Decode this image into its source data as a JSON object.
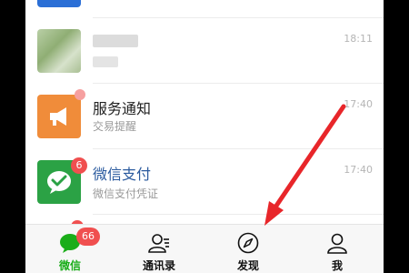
{
  "chats": [
    {
      "time": ""
    },
    {
      "time": "18:11"
    },
    {
      "title": "服务通知",
      "subtitle": "交易提醒",
      "time": "17:40"
    },
    {
      "title": "微信支付",
      "subtitle": "微信支付凭证",
      "time": "17:40",
      "badge": "6"
    }
  ],
  "tabs": [
    {
      "label": "微信",
      "badge": "66",
      "icon": "chat-bubble-icon",
      "active": true
    },
    {
      "label": "通讯录",
      "icon": "contacts-icon"
    },
    {
      "label": "发现",
      "icon": "compass-icon"
    },
    {
      "label": "我",
      "icon": "person-icon"
    }
  ],
  "colors": {
    "accent": "#1aad19",
    "badge": "#f04f4f",
    "service_orange": "#f08c3a",
    "pay_green": "#2ba245",
    "annotation_arrow": "#e8262a"
  }
}
